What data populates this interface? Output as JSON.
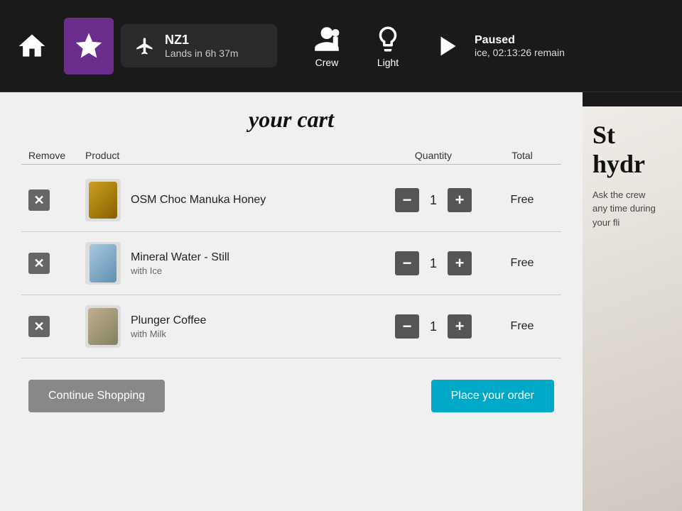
{
  "topbar": {
    "home_icon": "home",
    "favorites_icon": "star",
    "flight": {
      "number": "NZ1",
      "lands_label": "Lands in 6h 37m"
    },
    "crew_label": "Crew",
    "light_label": "Light",
    "playback": {
      "status": "Paused",
      "remaining": "ice, 02:13:26 remain"
    }
  },
  "cart": {
    "title": "your cart",
    "columns": {
      "remove": "Remove",
      "product": "Product",
      "quantity": "Quantity",
      "total": "Total"
    },
    "items": [
      {
        "id": 1,
        "name": "OSM Choc Manuka Honey",
        "sub": "",
        "quantity": 1,
        "total": "Free",
        "thumb_type": "honey"
      },
      {
        "id": 2,
        "name": "Mineral Water - Still",
        "sub": "with Ice",
        "quantity": 1,
        "total": "Free",
        "thumb_type": "water"
      },
      {
        "id": 3,
        "name": "Plunger Coffee",
        "sub": "with Milk",
        "quantity": 1,
        "total": "Free",
        "thumb_type": "coffee"
      }
    ],
    "continue_btn": "Continue Shopping",
    "order_btn": "Place your order"
  },
  "promo": {
    "title_part1": "St",
    "title_part2": "hydr",
    "body": "Ask the crew any time during your fli"
  }
}
